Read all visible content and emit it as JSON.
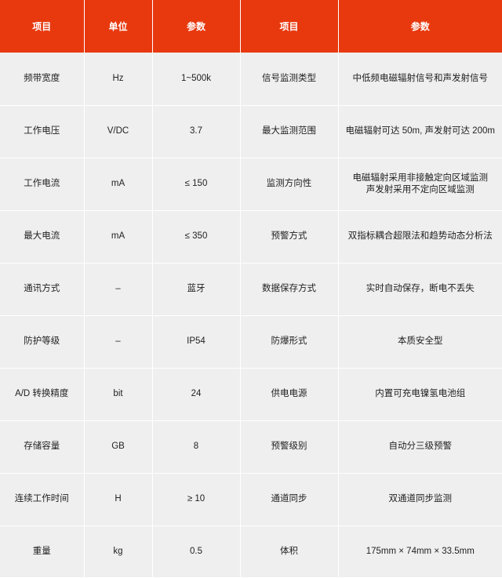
{
  "header": {
    "item_a": "项目",
    "unit": "单位",
    "param_a": "参数",
    "item_b": "项目",
    "param_b": "参数"
  },
  "rows": [
    {
      "item_a": "频带宽度",
      "unit": "Hz",
      "param_a": "1~500k",
      "item_b": "信号监测类型",
      "param_b": [
        "中低频电磁辐射信号和声发射信号"
      ]
    },
    {
      "item_a": "工作电压",
      "unit": "V/DC",
      "param_a": "3.7",
      "item_b": "最大监测范围",
      "param_b": [
        "电磁辐射可达 50m, 声发射可达 200m"
      ]
    },
    {
      "item_a": "工作电流",
      "unit": "mA",
      "param_a": "≤ 150",
      "item_b": "监测方向性",
      "param_b": [
        "电磁辐射采用非接触定向区域监测",
        "声发射采用不定向区域监测"
      ]
    },
    {
      "item_a": "最大电流",
      "unit": "mA",
      "param_a": "≤ 350",
      "item_b": "预警方式",
      "param_b": [
        "双指标耦合超限法和趋势动态分析法"
      ]
    },
    {
      "item_a": "通讯方式",
      "unit": "–",
      "param_a": "蓝牙",
      "item_b": "数据保存方式",
      "param_b": [
        "实时自动保存，断电不丢失"
      ]
    },
    {
      "item_a": "防护等级",
      "unit": "–",
      "param_a": "IP54",
      "item_b": "防爆形式",
      "param_b": [
        "本质安全型"
      ]
    },
    {
      "item_a": "A/D 转换精度",
      "unit": "bit",
      "param_a": "24",
      "item_b": "供电电源",
      "param_b": [
        "内置可充电镍氢电池组"
      ]
    },
    {
      "item_a": "存储容量",
      "unit": "GB",
      "param_a": "8",
      "item_b": "预警级别",
      "param_b": [
        "自动分三级预警"
      ]
    },
    {
      "item_a": "连续工作时间",
      "unit": "H",
      "param_a": "≥ 10",
      "item_b": "通道同步",
      "param_b": [
        "双通道同步监测"
      ]
    },
    {
      "item_a": "重量",
      "unit": "kg",
      "param_a": "0.5",
      "item_b": "体积",
      "param_b": [
        "175mm × 74mm × 33.5mm"
      ]
    }
  ],
  "colors": {
    "header_bg": "#e8380e",
    "header_text": "#ffffff",
    "cell_bg": "#efefef",
    "cell_text": "#222222"
  }
}
